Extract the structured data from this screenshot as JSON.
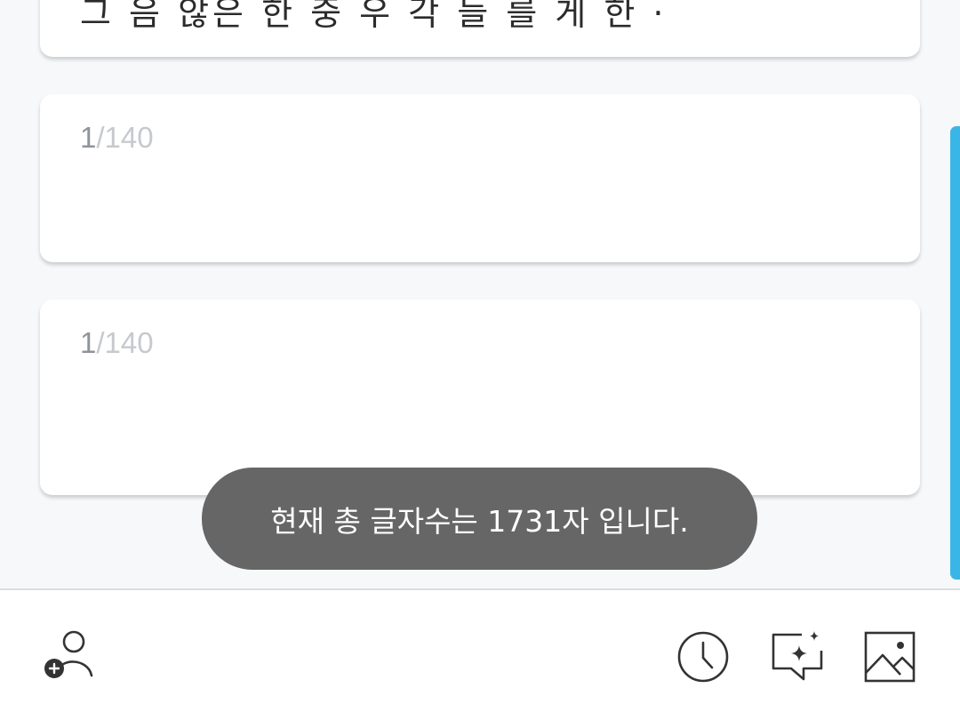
{
  "cards": {
    "previous": {
      "text": "그 음 않은 한 중 우 각 들 를 게 한 ·"
    },
    "card1": {
      "current": "1",
      "separator": "/",
      "max": "140"
    },
    "card2": {
      "current": "1",
      "separator": "/",
      "max": "140"
    }
  },
  "toast": {
    "message": "현재 총 글자수는 1731자 입니다."
  },
  "toolbar": {
    "icons": [
      "add-person-icon",
      "clock-icon",
      "ai-chat-sparkle-icon",
      "image-icon"
    ]
  },
  "colors": {
    "background": "#f7f8fa",
    "card": "#ffffff",
    "toast_bg": "#666666",
    "scrollbar": "#3ab6e6",
    "counter_muted": "#c6c9ce",
    "icon": "#333333"
  }
}
